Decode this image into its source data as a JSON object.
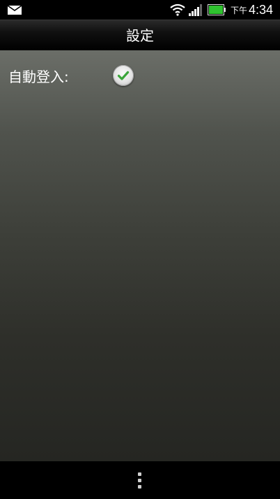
{
  "status_bar": {
    "ampm": "下午",
    "time": "4:34",
    "icons": [
      "mail-icon",
      "wifi-icon",
      "signal-icon",
      "battery-icon"
    ],
    "battery_color": "#2fc22f"
  },
  "title_bar": {
    "title": "設定"
  },
  "settings": {
    "auto_login": {
      "label": "自動登入:",
      "checked": true,
      "check_color": "#3aa53a"
    }
  },
  "bottom_bar": {
    "menu_icon": "overflow-menu-icon"
  }
}
